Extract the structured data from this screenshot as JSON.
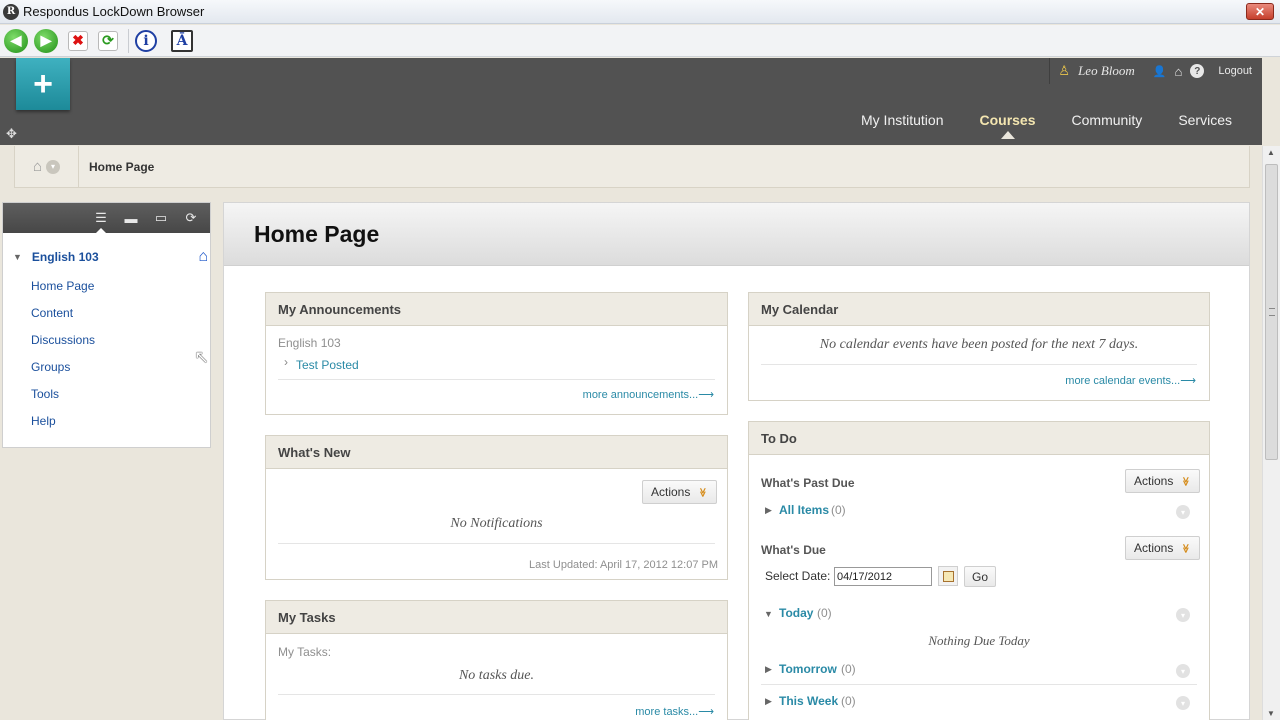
{
  "window": {
    "title": "Respondus LockDown Browser",
    "close_glyph": "✕",
    "app_icon_glyph": "R"
  },
  "toolbar": {
    "back_glyph": "◀",
    "forward_glyph": "▶",
    "stop_glyph": "✖",
    "refresh_glyph": "⟳",
    "info_glyph": "i",
    "text_glyph": "Ā"
  },
  "header": {
    "logo_glyph": "+",
    "move_glyph": "✥",
    "user_icon_glyph": "♙",
    "username": "Leo Bloom",
    "person_glyph": "👤",
    "home_glyph": "⌂",
    "help_glyph": "?",
    "logout": "Logout",
    "tabs": [
      "My Institution",
      "Courses",
      "Community",
      "Services"
    ],
    "active_tab": "Courses"
  },
  "breadcrumb": {
    "home_glyph": "⌂",
    "chev_glyph": "▾",
    "current": "Home Page"
  },
  "course_menu": {
    "tool_glyphs": [
      "☰",
      "▬",
      "▭",
      "⟳"
    ],
    "course_name": "English 103",
    "tri_glyph": "▼",
    "home_glyph": "⌂",
    "items": [
      "Home Page",
      "Content",
      "Discussions",
      "Groups",
      "Tools",
      "Help"
    ]
  },
  "scrollbar": {
    "up_glyph": "▲",
    "down_glyph": "▼"
  },
  "cursor_glyph": "↖",
  "page": {
    "title": "Home Page"
  },
  "announcements": {
    "title": "My Announcements",
    "course": "English 103",
    "item_glyph": "›",
    "item": "Test Posted",
    "more": "more announcements...⟶"
  },
  "whats_new": {
    "title": "What's New",
    "actions": "Actions",
    "dd_glyph": "≫",
    "empty": "No Notifications",
    "updated": "Last Updated: April 17, 2012 12:07 PM"
  },
  "tasks": {
    "title": "My Tasks",
    "label": "My Tasks:",
    "empty": "No tasks due.",
    "more": "more tasks...⟶"
  },
  "calendar": {
    "title": "My Calendar",
    "empty": "No calendar events have been posted for the next 7 days.",
    "more": "more calendar events...⟶"
  },
  "todo": {
    "title": "To Do",
    "past_due_title": "What's Past Due",
    "actions": "Actions",
    "dd_glyph": "≫",
    "all_items": "All Items",
    "all_items_count": "(0)",
    "due_title": "What's Due",
    "select_date_label": "Select Date:",
    "date_value": "04/17/2012",
    "go": "Go",
    "tri_right": "▶",
    "tri_down": "▼",
    "circle_glyph": "▾",
    "today": "Today",
    "today_count": "(0)",
    "nothing_due": "Nothing Due Today",
    "tomorrow": "Tomorrow",
    "tomorrow_count": "(0)",
    "this_week": "This Week",
    "this_week_count": "(0)"
  }
}
